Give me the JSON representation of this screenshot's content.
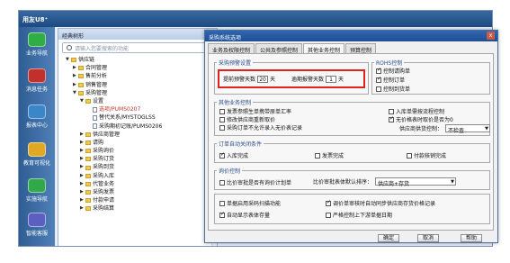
{
  "app": {
    "title": "用友U8⁺",
    "nav": [
      {
        "label": "业务导航",
        "color": "#2fae45"
      },
      {
        "label": "消息任务",
        "color": "#c2302c"
      },
      {
        "label": "报表中心",
        "color": "#3a86c8"
      },
      {
        "label": "教育可视化",
        "color": "#e0a823"
      },
      {
        "label": "实施导航",
        "color": "#31a84a"
      },
      {
        "label": "智能客服",
        "color": "#5c5fbf"
      }
    ]
  },
  "tree": {
    "header": "经典树形",
    "search_placeholder": "请输入您要搜索的功能",
    "nodes": [
      {
        "label": "供应链",
        "indent": 1,
        "exp": "▼",
        "kind": "folder"
      },
      {
        "label": "合同管理",
        "indent": 2,
        "exp": "▶",
        "kind": "folder"
      },
      {
        "label": "售前分析",
        "indent": 2,
        "exp": "▶",
        "kind": "folder"
      },
      {
        "label": "销售管理",
        "indent": 2,
        "exp": "▶",
        "kind": "folder"
      },
      {
        "label": "采购管理",
        "indent": 2,
        "exp": "▼",
        "kind": "folder"
      },
      {
        "label": "设置",
        "indent": 3,
        "exp": "▼",
        "kind": "folder"
      },
      {
        "label": "选项/PUMS0207",
        "indent": 4,
        "exp": "",
        "kind": "doc",
        "selected": true
      },
      {
        "label": "替代关系/MYSTOGLSS",
        "indent": 4,
        "exp": "",
        "kind": "doc"
      },
      {
        "label": "采购期初记账/PUMS0206",
        "indent": 4,
        "exp": "",
        "kind": "doc"
      },
      {
        "label": "供应商管理",
        "indent": 3,
        "exp": "▶",
        "kind": "folder"
      },
      {
        "label": "请购",
        "indent": 3,
        "exp": "▶",
        "kind": "folder"
      },
      {
        "label": "采购询价",
        "indent": 3,
        "exp": "▶",
        "kind": "folder"
      },
      {
        "label": "采购订货",
        "indent": 3,
        "exp": "▶",
        "kind": "folder"
      },
      {
        "label": "采购到货",
        "indent": 3,
        "exp": "▶",
        "kind": "folder"
      },
      {
        "label": "采购入库",
        "indent": 3,
        "exp": "▶",
        "kind": "folder"
      },
      {
        "label": "代管业务",
        "indent": 3,
        "exp": "▶",
        "kind": "folder"
      },
      {
        "label": "采购发票",
        "indent": 3,
        "exp": "▶",
        "kind": "folder"
      },
      {
        "label": "付款申请",
        "indent": 3,
        "exp": "▶",
        "kind": "folder"
      },
      {
        "label": "采购结算",
        "indent": 3,
        "exp": "▶",
        "kind": "folder"
      }
    ]
  },
  "dialog": {
    "title": "采购系统选项",
    "close": "x",
    "tabs": [
      "业务及权限控制",
      "公共及参照控制",
      "其他业务控制",
      "预算控制"
    ],
    "active_tab": 2,
    "warning_group": {
      "label": "采购预警设置",
      "advance_label": "提前预警天数",
      "advance_value": "20",
      "advance_unit": "天",
      "overdue_label": "逾期报警天数",
      "overdue_value": "1",
      "overdue_unit": "天"
    },
    "rohs_group": {
      "label": "ROHS控制",
      "items": [
        {
          "label": "控制请购单",
          "checked": true
        },
        {
          "label": "控制订单",
          "checked": true
        },
        {
          "label": "控制到货单",
          "checked": false
        }
      ]
    },
    "other_group": {
      "label": "其他业务控制",
      "left": [
        {
          "label": "发票参照生单携带原单汇率",
          "checked": false
        },
        {
          "label": "修改供应商重新取价",
          "checked": false
        },
        {
          "label": "采购订单不允许录入无价表记录",
          "checked": false
        }
      ],
      "right": [
        {
          "label": "入库单需按流程控制",
          "checked": false
        },
        {
          "label": "无价格表时取价是否为0",
          "checked": true
        }
      ],
      "supplier_label": "供应商供货控制：",
      "supplier_value": "不检查"
    },
    "auto_close_group": {
      "label": "订单自动关闭条件",
      "items": [
        {
          "label": "入库完成",
          "checked": true
        },
        {
          "label": "发票完成",
          "checked": false
        },
        {
          "label": "付款核销完成",
          "checked": false
        }
      ]
    },
    "price_group": {
      "label": "询价控制",
      "item": {
        "label": "比价审批是否有询价计划单",
        "checked": false
      },
      "sort_label": "比价审批表体默认排序：",
      "sort_value": "供应商+存货"
    },
    "bottom": {
      "left": [
        {
          "label": "单据启用采码扫描功能",
          "checked": false
        },
        {
          "label": "自动显示表体存量",
          "checked": true
        }
      ],
      "right": [
        {
          "label": "调价单审核时自动同步供应商存货价格记录",
          "checked": true
        },
        {
          "label": "严格控制上下游单据日期",
          "checked": false
        }
      ]
    },
    "buttons": {
      "ok": "确定",
      "cancel": "取消",
      "help": "帮助"
    }
  }
}
